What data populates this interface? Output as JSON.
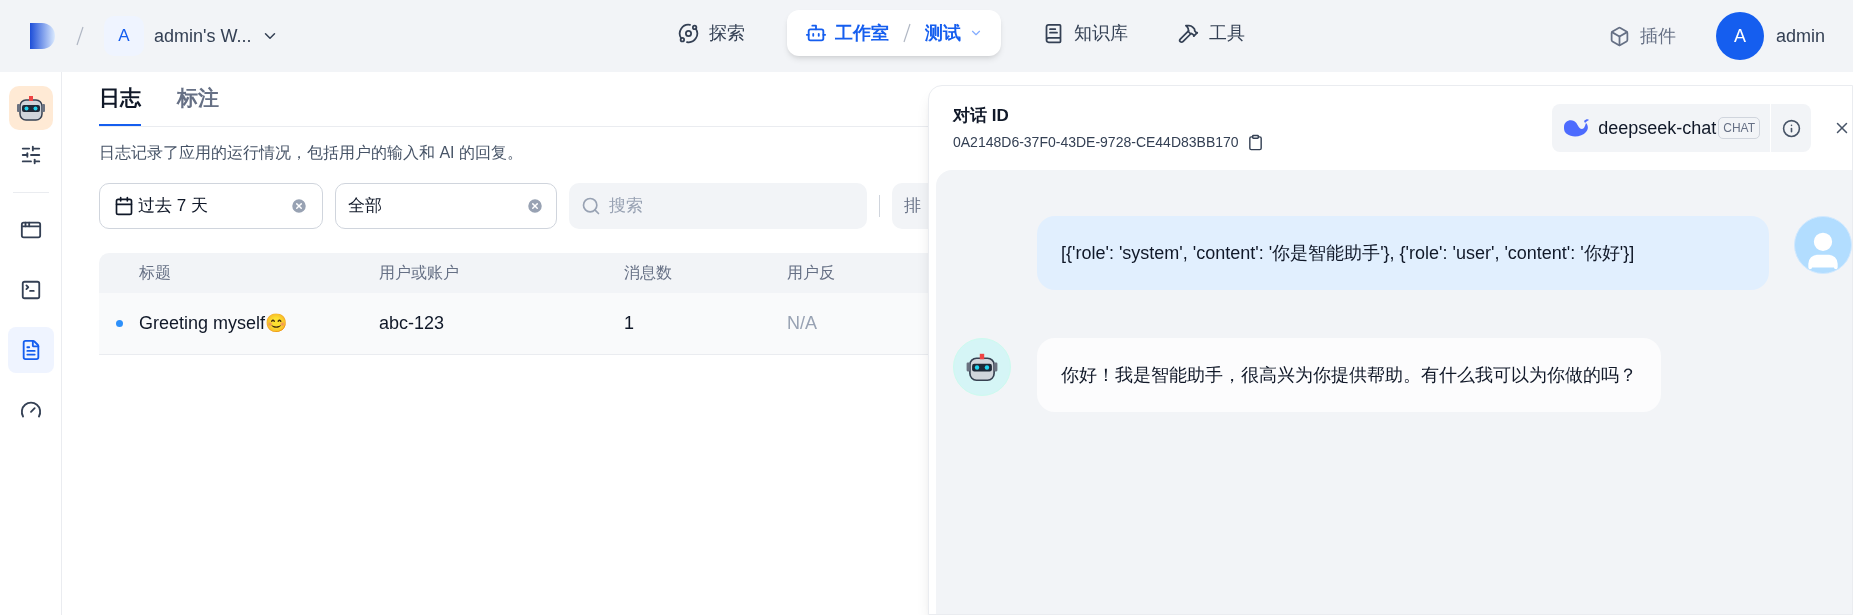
{
  "topbar": {
    "workspace": {
      "initial": "A",
      "name": "admin's W..."
    },
    "nav": [
      {
        "kind": "explore",
        "label": "探索",
        "selected": false
      },
      {
        "kind": "studio",
        "label": "工作室",
        "app": "测试",
        "selected": true
      },
      {
        "kind": "knowledge",
        "label": "知识库",
        "selected": false
      },
      {
        "kind": "tools",
        "label": "工具",
        "selected": false
      }
    ],
    "plugins": "插件",
    "user": {
      "initial": "A",
      "name": "admin"
    }
  },
  "sidebar": {
    "items": [
      {
        "kind": "settings",
        "selected": false
      },
      {
        "kind": "window",
        "selected": false
      },
      {
        "kind": "terminal",
        "selected": false
      },
      {
        "kind": "logs",
        "selected": true
      },
      {
        "kind": "gauge",
        "selected": false
      }
    ]
  },
  "tabs": [
    {
      "label": "日志",
      "selected": true
    },
    {
      "label": "标注",
      "selected": false
    }
  ],
  "description": "日志记录了应用的运行情况，包括用户的输入和 AI 的回复。",
  "filters": {
    "period": "过去 7 天",
    "status": "全部",
    "search_placeholder": "搜索",
    "column_4": "排"
  },
  "table": {
    "columns": [
      "标题",
      "用户或账户",
      "消息数",
      "用户反"
    ],
    "rows": [
      {
        "title": "Greeting myself😊",
        "user": "abc-123",
        "messages": "1",
        "feedback": "N/A",
        "unread": true
      }
    ]
  },
  "conversation": {
    "title": "对话 ID",
    "id": "0A2148D6-37F0-43DE-9728-CE44D83BB170",
    "model": "deepseek-chat",
    "model_tag": "CHAT",
    "messages": [
      {
        "kind": "user",
        "text": "[{'role': 'system', 'content': '你是智能助手'}, {'role': 'user', 'content': '你好'}]"
      },
      {
        "kind": "assistant",
        "text": "你好！我是智能助手，很高兴为你提供帮助。有什么我可以为你做的吗？"
      }
    ]
  }
}
